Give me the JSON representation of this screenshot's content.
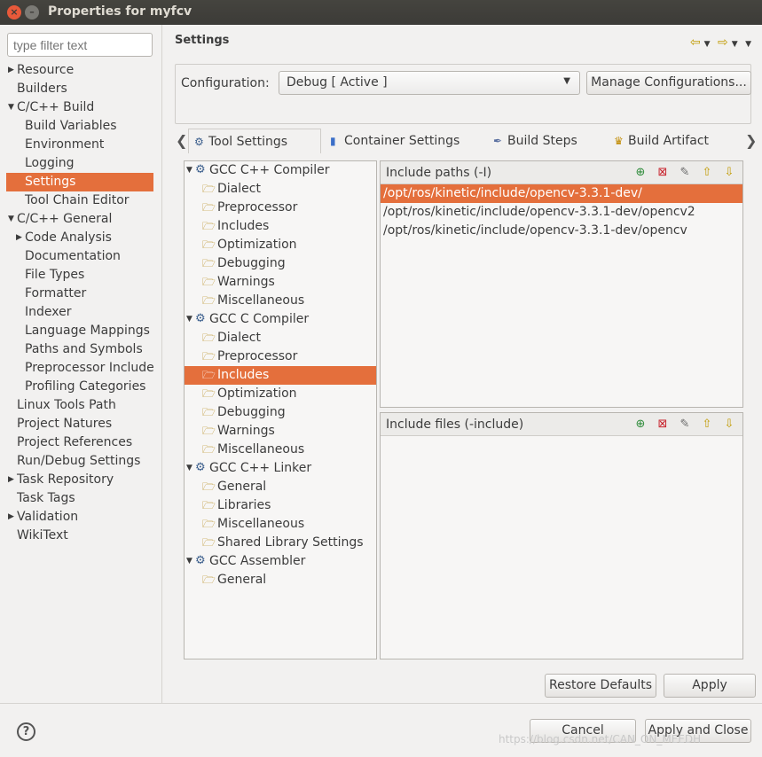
{
  "window": {
    "title": "Properties for myfcv"
  },
  "filter": {
    "placeholder": "type filter text"
  },
  "nav": [
    {
      "label": "Resource",
      "expandable": true,
      "level": 0
    },
    {
      "label": "Builders",
      "level": 0
    },
    {
      "label": "C/C++ Build",
      "expanded": true,
      "level": 0
    },
    {
      "label": "Build Variables",
      "level": 1
    },
    {
      "label": "Environment",
      "level": 1
    },
    {
      "label": "Logging",
      "level": 1
    },
    {
      "label": "Settings",
      "level": 1,
      "selected": true
    },
    {
      "label": "Tool Chain Editor",
      "level": 1
    },
    {
      "label": "C/C++ General",
      "expanded": true,
      "level": 0
    },
    {
      "label": "Code Analysis",
      "expandable": true,
      "level": 1
    },
    {
      "label": "Documentation",
      "level": 1
    },
    {
      "label": "File Types",
      "level": 1
    },
    {
      "label": "Formatter",
      "level": 1
    },
    {
      "label": "Indexer",
      "level": 1
    },
    {
      "label": "Language Mappings",
      "level": 1
    },
    {
      "label": "Paths and Symbols",
      "level": 1
    },
    {
      "label": "Preprocessor Include",
      "level": 1
    },
    {
      "label": "Profiling Categories",
      "level": 1
    },
    {
      "label": "Linux Tools Path",
      "level": 0
    },
    {
      "label": "Project Natures",
      "level": 0
    },
    {
      "label": "Project References",
      "level": 0
    },
    {
      "label": "Run/Debug Settings",
      "level": 0
    },
    {
      "label": "Task Repository",
      "expandable": true,
      "level": 0
    },
    {
      "label": "Task Tags",
      "level": 0
    },
    {
      "label": "Validation",
      "expandable": true,
      "level": 0
    },
    {
      "label": "WikiText",
      "level": 0
    }
  ],
  "page": {
    "title": "Settings"
  },
  "configuration": {
    "label": "Configuration:",
    "selected": "Debug  [ Active ]",
    "manage_label": "Manage Configurations..."
  },
  "tabs": [
    {
      "label": "Tool Settings",
      "icon": "tool-settings-icon",
      "active": true
    },
    {
      "label": "Container Settings",
      "icon": "container-icon"
    },
    {
      "label": "Build Steps",
      "icon": "build-steps-icon"
    },
    {
      "label": "Build Artifact",
      "icon": "build-artifact-icon"
    }
  ],
  "tree": [
    {
      "label": "GCC C++ Compiler",
      "type": "tool"
    },
    {
      "label": "Dialect",
      "type": "option"
    },
    {
      "label": "Preprocessor",
      "type": "option"
    },
    {
      "label": "Includes",
      "type": "option"
    },
    {
      "label": "Optimization",
      "type": "option"
    },
    {
      "label": "Debugging",
      "type": "option"
    },
    {
      "label": "Warnings",
      "type": "option"
    },
    {
      "label": "Miscellaneous",
      "type": "option"
    },
    {
      "label": "GCC C Compiler",
      "type": "tool"
    },
    {
      "label": "Dialect",
      "type": "option"
    },
    {
      "label": "Preprocessor",
      "type": "option"
    },
    {
      "label": "Includes",
      "type": "option",
      "selected": true
    },
    {
      "label": "Optimization",
      "type": "option"
    },
    {
      "label": "Debugging",
      "type": "option"
    },
    {
      "label": "Warnings",
      "type": "option"
    },
    {
      "label": "Miscellaneous",
      "type": "option"
    },
    {
      "label": "GCC C++ Linker",
      "type": "tool"
    },
    {
      "label": "General",
      "type": "option"
    },
    {
      "label": "Libraries",
      "type": "option"
    },
    {
      "label": "Miscellaneous",
      "type": "option"
    },
    {
      "label": "Shared Library Settings",
      "type": "option"
    },
    {
      "label": "GCC Assembler",
      "type": "tool"
    },
    {
      "label": "General",
      "type": "option"
    }
  ],
  "include_paths": {
    "header": "Include paths (-I)",
    "items": [
      "/opt/ros/kinetic/include/opencv-3.3.1-dev/",
      "/opt/ros/kinetic/include/opencv-3.3.1-dev/opencv2",
      "/opt/ros/kinetic/include/opencv-3.3.1-dev/opencv"
    ],
    "selected_index": 0
  },
  "include_files": {
    "header": "Include files (-include)",
    "items": []
  },
  "buttons": {
    "restore_defaults": "Restore Defaults",
    "apply": "Apply",
    "cancel": "Cancel",
    "apply_and_close": "Apply and Close"
  },
  "watermark": "https://blog.csdn.net/CAN_ON_MEEDH"
}
